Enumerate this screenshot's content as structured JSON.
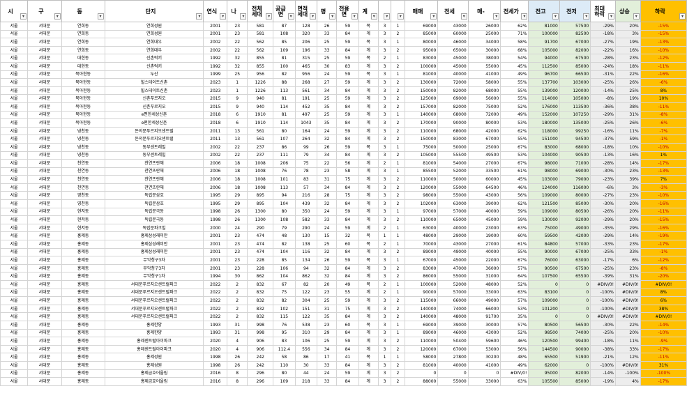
{
  "columns": [
    {
      "label": "시",
      "style": "",
      "align": "c"
    },
    {
      "label": "구",
      "style": "",
      "align": "c"
    },
    {
      "label": "동",
      "style": "",
      "align": "c"
    },
    {
      "label": "단지",
      "style": "",
      "align": "c"
    },
    {
      "label": "연식",
      "style": "",
      "align": "c"
    },
    {
      "label": "나",
      "style": "",
      "align": "c"
    },
    {
      "label": "전체 세대",
      "style": "",
      "align": "c"
    },
    {
      "label": "공급 면",
      "style": "",
      "align": "c"
    },
    {
      "label": "면적 세대",
      "style": "",
      "align": "c"
    },
    {
      "label": "평",
      "style": "",
      "align": "c"
    },
    {
      "label": "전용 면",
      "style": "",
      "align": "c"
    },
    {
      "label": "계",
      "style": "",
      "align": "c"
    },
    {
      "label": "",
      "style": "",
      "align": "c"
    },
    {
      "label": "",
      "style": "",
      "align": "c"
    },
    {
      "label": "매매",
      "style": "",
      "align": "r"
    },
    {
      "label": "전세",
      "style": "",
      "align": "r"
    },
    {
      "label": "매-",
      "style": "",
      "align": "r"
    },
    {
      "label": "전세가",
      "style": "",
      "align": "r"
    },
    {
      "label": "전고",
      "style": "hb",
      "align": "r"
    },
    {
      "label": "전저",
      "style": "hb",
      "align": "r"
    },
    {
      "label": "최대 하락",
      "style": "",
      "align": "r"
    },
    {
      "label": "상승",
      "style": "hg",
      "align": "r"
    },
    {
      "label": "하락",
      "style": "ho",
      "align": "c"
    }
  ],
  "rows": [
    [
      "서울",
      "서대문",
      "연희동",
      "연희성원",
      "2001",
      "23",
      "581",
      "87",
      "128",
      "26",
      "59",
      "복",
      "3",
      "1",
      "69000",
      "43000",
      "26000",
      "62%",
      "81000",
      "57500",
      "-29%",
      "20%",
      "-15%"
    ],
    [
      "서울",
      "서대문",
      "연희동",
      "연희성원",
      "2001",
      "23",
      "581",
      "108",
      "320",
      "33",
      "84",
      "계",
      "3",
      "2",
      "85000",
      "60000",
      "25000",
      "71%",
      "100000",
      "82500",
      "-18%",
      "3%",
      "-15%"
    ],
    [
      "서울",
      "서대문",
      "연희동",
      "연희대우",
      "2002",
      "22",
      "562",
      "85",
      "206",
      "25",
      "59",
      "복",
      "3",
      "1",
      "80000",
      "46000",
      "34000",
      "58%",
      "91700",
      "67000",
      "-27%",
      "19%",
      "-13%"
    ],
    [
      "서울",
      "서대문",
      "연희동",
      "연희대우",
      "2002",
      "22",
      "562",
      "109",
      "196",
      "33",
      "84",
      "계",
      "3",
      "2",
      "95000",
      "65000",
      "30000",
      "68%",
      "105000",
      "82000",
      "-22%",
      "16%",
      "-10%"
    ],
    [
      "서울",
      "서대문",
      "대현동",
      "신촌럭키",
      "1992",
      "32",
      "855",
      "81",
      "315",
      "25",
      "59",
      "복",
      "2",
      "1",
      "83000",
      "45000",
      "38000",
      "54%",
      "94000",
      "67500",
      "-28%",
      "23%",
      "-12%"
    ],
    [
      "서울",
      "서대문",
      "대현동",
      "신촌럭키",
      "1992",
      "32",
      "855",
      "100",
      "465",
      "30",
      "83",
      "계",
      "3",
      "2",
      "100000",
      "45000",
      "55000",
      "45%",
      "112500",
      "85000",
      "-24%",
      "18%",
      "-11%"
    ],
    [
      "서울",
      "서대문",
      "북아현동",
      "두산",
      "1999",
      "25",
      "956",
      "82",
      "956",
      "24",
      "59",
      "복",
      "3",
      "1",
      "81000",
      "40000",
      "41000",
      "49%",
      "96700",
      "66500",
      "-31%",
      "22%",
      "-16%"
    ],
    [
      "서울",
      "서대문",
      "북아현동",
      "힐스테이트신촌",
      "2023",
      "1",
      "1226",
      "88",
      "268",
      "27",
      "59",
      "계",
      "3",
      "2",
      "130000",
      "72000",
      "58000",
      "55%",
      "137700",
      "103000",
      "-25%",
      "26%",
      "-6%"
    ],
    [
      "서울",
      "서대문",
      "북아현동",
      "힐스테이트신촌",
      "2023",
      "1",
      "1226",
      "113",
      "561",
      "34",
      "84",
      "계",
      "3",
      "2",
      "150000",
      "82000",
      "68000",
      "55%",
      "139000",
      "120000",
      "-14%",
      "25%",
      "8%"
    ],
    [
      "서울",
      "서대문",
      "북아현동",
      "신촌푸르지오",
      "2015",
      "9",
      "940",
      "81",
      "191",
      "25",
      "59",
      "계",
      "3",
      "2",
      "125000",
      "69000",
      "56000",
      "55%",
      "114000",
      "105000",
      "-8%",
      "19%",
      "10%"
    ],
    [
      "서울",
      "서대문",
      "북아현동",
      "신촌푸르지오",
      "2015",
      "9",
      "940",
      "114",
      "452",
      "35",
      "84",
      "계",
      "3",
      "2",
      "157000",
      "82000",
      "75000",
      "52%",
      "176000",
      "113500",
      "-36%",
      "38%",
      "-11%"
    ],
    [
      "서울",
      "서대문",
      "북아현동",
      "e편한세상신촌",
      "2018",
      "6",
      "1910",
      "81",
      "497",
      "25",
      "59",
      "계",
      "3",
      "1",
      "140000",
      "68000",
      "72000",
      "49%",
      "152000",
      "107250",
      "-29%",
      "31%",
      "-8%"
    ],
    [
      "서울",
      "서대문",
      "북아현동",
      "e편한세상신촌",
      "2018",
      "6",
      "1910",
      "114",
      "1043",
      "35",
      "84",
      "계",
      "3",
      "2",
      "170000",
      "90000",
      "80000",
      "53%",
      "180000",
      "135000",
      "-25%",
      "26%",
      "-6%"
    ],
    [
      "서울",
      "서대문",
      "냉천동",
      "돈의문푸르지오센트럴",
      "2011",
      "13",
      "561",
      "80",
      "164",
      "24",
      "59",
      "계",
      "3",
      "2",
      "110000",
      "68000",
      "42000",
      "62%",
      "118000",
      "99250",
      "-16%",
      "11%",
      "-7%"
    ],
    [
      "서울",
      "서대문",
      "냉천동",
      "돈의문푸르지오센트럴",
      "2011",
      "13",
      "561",
      "107",
      "264",
      "32",
      "84",
      "계",
      "3",
      "2",
      "150000",
      "83000",
      "67000",
      "55%",
      "151000",
      "94500",
      "-37%",
      "59%",
      "-1%"
    ],
    [
      "서울",
      "서대문",
      "냉천동",
      "동부센트레빌",
      "2002",
      "22",
      "237",
      "86",
      "99",
      "26",
      "59",
      "복",
      "3",
      "1",
      "75000",
      "50000",
      "25000",
      "67%",
      "83000",
      "68000",
      "-18%",
      "10%",
      "-10%"
    ],
    [
      "서울",
      "서대문",
      "냉천동",
      "동부센트레빌",
      "2002",
      "22",
      "237",
      "111",
      "79",
      "34",
      "84",
      "계",
      "3",
      "2",
      "105000",
      "55500",
      "49500",
      "53%",
      "104000",
      "90500",
      "-13%",
      "16%",
      "1%"
    ],
    [
      "서울",
      "서대문",
      "천연동",
      "천연뜨란채",
      "2006",
      "18",
      "1008",
      "206",
      "75",
      "22",
      "56",
      "계",
      "2",
      "1",
      "81000",
      "54000",
      "27000",
      "67%",
      "98000",
      "71000",
      "-28%",
      "14%",
      "-17%"
    ],
    [
      "서울",
      "서대문",
      "천연동",
      "천연뜨란채",
      "2006",
      "18",
      "1008",
      "76",
      "78",
      "23",
      "58",
      "계",
      "3",
      "1",
      "85500",
      "52000",
      "33500",
      "61%",
      "98000",
      "69000",
      "-30%",
      "23%",
      "-13%"
    ],
    [
      "서울",
      "서대문",
      "천연동",
      "천연뜨란채",
      "2006",
      "18",
      "1008",
      "101",
      "83",
      "31",
      "75",
      "계",
      "3",
      "2",
      "110000",
      "50000",
      "60000",
      "45%",
      "103000",
      "79000",
      "-23%",
      "39%",
      "7%"
    ],
    [
      "서울",
      "서대문",
      "천연동",
      "천연뜨란채",
      "2006",
      "18",
      "1008",
      "113",
      "57",
      "34",
      "84",
      "계",
      "3",
      "2",
      "120000",
      "55000",
      "64500",
      "46%",
      "124000",
      "116000",
      "-6%",
      "3%",
      "-3%"
    ],
    [
      "서울",
      "서대문",
      "영천동",
      "독립문삼호",
      "1995",
      "29",
      "895",
      "94",
      "216",
      "28",
      "75",
      "계",
      "3",
      "2",
      "98000",
      "55000",
      "43000",
      "56%",
      "109000",
      "80000",
      "-27%",
      "23%",
      "-10%"
    ],
    [
      "서울",
      "서대문",
      "영천동",
      "독립문삼호",
      "1995",
      "29",
      "895",
      "104",
      "439",
      "32",
      "84",
      "계",
      "3",
      "2",
      "102000",
      "63000",
      "39000",
      "62%",
      "121500",
      "85000",
      "-30%",
      "20%",
      "-16%"
    ],
    [
      "서울",
      "서대문",
      "현저동",
      "독립문극동",
      "1998",
      "26",
      "1300",
      "80",
      "350",
      "24",
      "59",
      "계",
      "3",
      "1",
      "97000",
      "57000",
      "40000",
      "59%",
      "109000",
      "80500",
      "-26%",
      "20%",
      "-11%"
    ],
    [
      "서울",
      "서대문",
      "현저동",
      "독립문극동",
      "1998",
      "26",
      "1300",
      "108",
      "582",
      "33",
      "84",
      "계",
      "3",
      "2",
      "110000",
      "65000",
      "45000",
      "59%",
      "130000",
      "92000",
      "-29%",
      "20%",
      "-15%"
    ],
    [
      "서울",
      "서대문",
      "현저동",
      "독립문파크빌",
      "2000",
      "24",
      "290",
      "79",
      "290",
      "24",
      "59",
      "계",
      "2",
      "1",
      "63000",
      "40000",
      "23000",
      "63%",
      "75000",
      "49000",
      "-35%",
      "29%",
      "-16%"
    ],
    [
      "서울",
      "서대문",
      "홍제동",
      "홍제삼성래미안",
      "2001",
      "23",
      "474",
      "48",
      "130",
      "15",
      "32",
      "복",
      "1",
      "1",
      "48000",
      "29000",
      "19000",
      "60%",
      "59500",
      "42000",
      "-29%",
      "14%",
      "-19%"
    ],
    [
      "서울",
      "서대문",
      "홍제동",
      "홍제삼성래미안",
      "2001",
      "23",
      "474",
      "82",
      "138",
      "25",
      "60",
      "복",
      "2",
      "1",
      "70000",
      "43000",
      "27000",
      "61%",
      "84800",
      "57000",
      "-33%",
      "23%",
      "-17%"
    ],
    [
      "서울",
      "서대문",
      "홍제동",
      "홍제삼성래미안",
      "2001",
      "23",
      "474",
      "104",
      "116",
      "32",
      "84",
      "계",
      "3",
      "2",
      "89000",
      "49000",
      "40000",
      "55%",
      "90000",
      "67000",
      "-25%",
      "33%",
      "-1%"
    ],
    [
      "서울",
      "서대문",
      "홍제동",
      "무악청구3차",
      "2001",
      "23",
      "228",
      "85",
      "134",
      "26",
      "59",
      "복",
      "3",
      "1",
      "67000",
      "45000",
      "22000",
      "67%",
      "76000",
      "63000",
      "-17%",
      "6%",
      "-12%"
    ],
    [
      "서울",
      "서대문",
      "홍제동",
      "무악청구3차",
      "2001",
      "23",
      "228",
      "106",
      "94",
      "32",
      "84",
      "계",
      "3",
      "2",
      "83000",
      "47000",
      "36000",
      "57%",
      "90500",
      "67500",
      "-25%",
      "23%",
      "-8%"
    ],
    [
      "서울",
      "서대문",
      "홍제동",
      "무악청구1차",
      "1994",
      "30",
      "862",
      "104",
      "862",
      "32",
      "84",
      "계",
      "3",
      "2",
      "86000",
      "55000",
      "31000",
      "64%",
      "107500",
      "65500",
      "-39%",
      "31%",
      "-20%"
    ],
    [
      "서울",
      "서대문",
      "홍제동",
      "서대문푸르지오센트럴파크",
      "2022",
      "2",
      "832",
      "67",
      "82",
      "20",
      "49",
      "복",
      "2",
      "1",
      "100000",
      "52000",
      "48000",
      "52%",
      "0",
      "0",
      "#DIV/0!",
      "#DIV/0!",
      "#DIV/0!"
    ],
    [
      "서울",
      "서대문",
      "홍제동",
      "서대문푸르지오센트럴파크",
      "2022",
      "2",
      "832",
      "75",
      "122",
      "23",
      "55",
      "계",
      "2",
      "1",
      "90000",
      "57000",
      "33000",
      "63%",
      "83100",
      "0",
      "-100%",
      "#DIV/0!",
      "8%"
    ],
    [
      "서울",
      "서대문",
      "홍제동",
      "서대문푸르지오센트럴파크",
      "2022",
      "2",
      "832",
      "82",
      "304",
      "25",
      "59",
      "계",
      "3",
      "2",
      "115000",
      "66000",
      "49000",
      "57%",
      "109000",
      "0",
      "-100%",
      "#DIV/0!",
      "6%"
    ],
    [
      "서울",
      "서대문",
      "홍제동",
      "서대문푸르지오센트럴파크",
      "2022",
      "2",
      "832",
      "102",
      "151",
      "31",
      "75",
      "계",
      "3",
      "2",
      "140000",
      "74000",
      "66000",
      "53%",
      "101200",
      "0",
      "-100%",
      "#DIV/0!",
      "38%"
    ],
    [
      "서울",
      "서대문",
      "홍제동",
      "서대문푸르지오센트럴파크",
      "2022",
      "2",
      "832",
      "115",
      "122",
      "35",
      "84",
      "계",
      "3",
      "2",
      "140000",
      "48000",
      "91700",
      "35%",
      "0",
      "0",
      "#DIV/0!",
      "#DIV/0!",
      "#DIV/0!"
    ],
    [
      "서울",
      "서대문",
      "홍제동",
      "홍제한양",
      "1993",
      "31",
      "998",
      "76",
      "538",
      "23",
      "60",
      "복",
      "3",
      "1",
      "69000",
      "39000",
      "30000",
      "57%",
      "80500",
      "56500",
      "-30%",
      "22%",
      "-14%"
    ],
    [
      "서울",
      "서대문",
      "홍제동",
      "홍제한양",
      "1993",
      "31",
      "998",
      "95",
      "310",
      "29",
      "84",
      "계",
      "3",
      "1",
      "89000",
      "46000",
      "43000",
      "52%",
      "98500",
      "74000",
      "-25%",
      "20%",
      "-10%"
    ],
    [
      "서울",
      "서대문",
      "홍제동",
      "홍제센트럴아이파크",
      "2020",
      "4",
      "906",
      "83",
      "106",
      "25",
      "59",
      "계",
      "3",
      "2",
      "110000",
      "50400",
      "59600",
      "46%",
      "120500",
      "99400",
      "-18%",
      "11%",
      "-9%"
    ],
    [
      "서울",
      "서대문",
      "홍제동",
      "홍제센트럴아이파크",
      "2020",
      "4",
      "906",
      "112.4",
      "556",
      "34",
      "84",
      "계",
      "3",
      "2",
      "120000",
      "67000",
      "53000",
      "56%",
      "144500",
      "90000",
      "-38%",
      "33%",
      "-17%"
    ],
    [
      "서울",
      "서대문",
      "홍제동",
      "홍제성원",
      "1998",
      "26",
      "242",
      "58",
      "86",
      "17",
      "41",
      "복",
      "1",
      "1",
      "58000",
      "27800",
      "30200",
      "48%",
      "65500",
      "51900",
      "-21%",
      "12%",
      "-11%"
    ],
    [
      "서울",
      "서대문",
      "홍제동",
      "홍제성원",
      "1998",
      "26",
      "242",
      "110",
      "30",
      "33",
      "84",
      "계",
      "3",
      "2",
      "81000",
      "40000",
      "41000",
      "49%",
      "62000",
      "0",
      "-100%",
      "#DIV/0!",
      "31%"
    ],
    [
      "서울",
      "서대문",
      "홍제동",
      "홍제금호어울림",
      "2016",
      "8",
      "296",
      "80",
      "44",
      "24",
      "59",
      "계",
      "3",
      "2",
      "0",
      "0",
      "0",
      "#DIV/0!",
      "95000",
      "82000",
      "-14%",
      "-100%",
      "-100%"
    ],
    [
      "서울",
      "서대문",
      "홍제동",
      "홍제금호어울림",
      "2016",
      "8",
      "296",
      "109",
      "218",
      "33",
      "84",
      "계",
      "3",
      "2",
      "88000",
      "55000",
      "33000",
      "63%",
      "105500",
      "85000",
      "-19%",
      "4%",
      "-17%"
    ]
  ]
}
